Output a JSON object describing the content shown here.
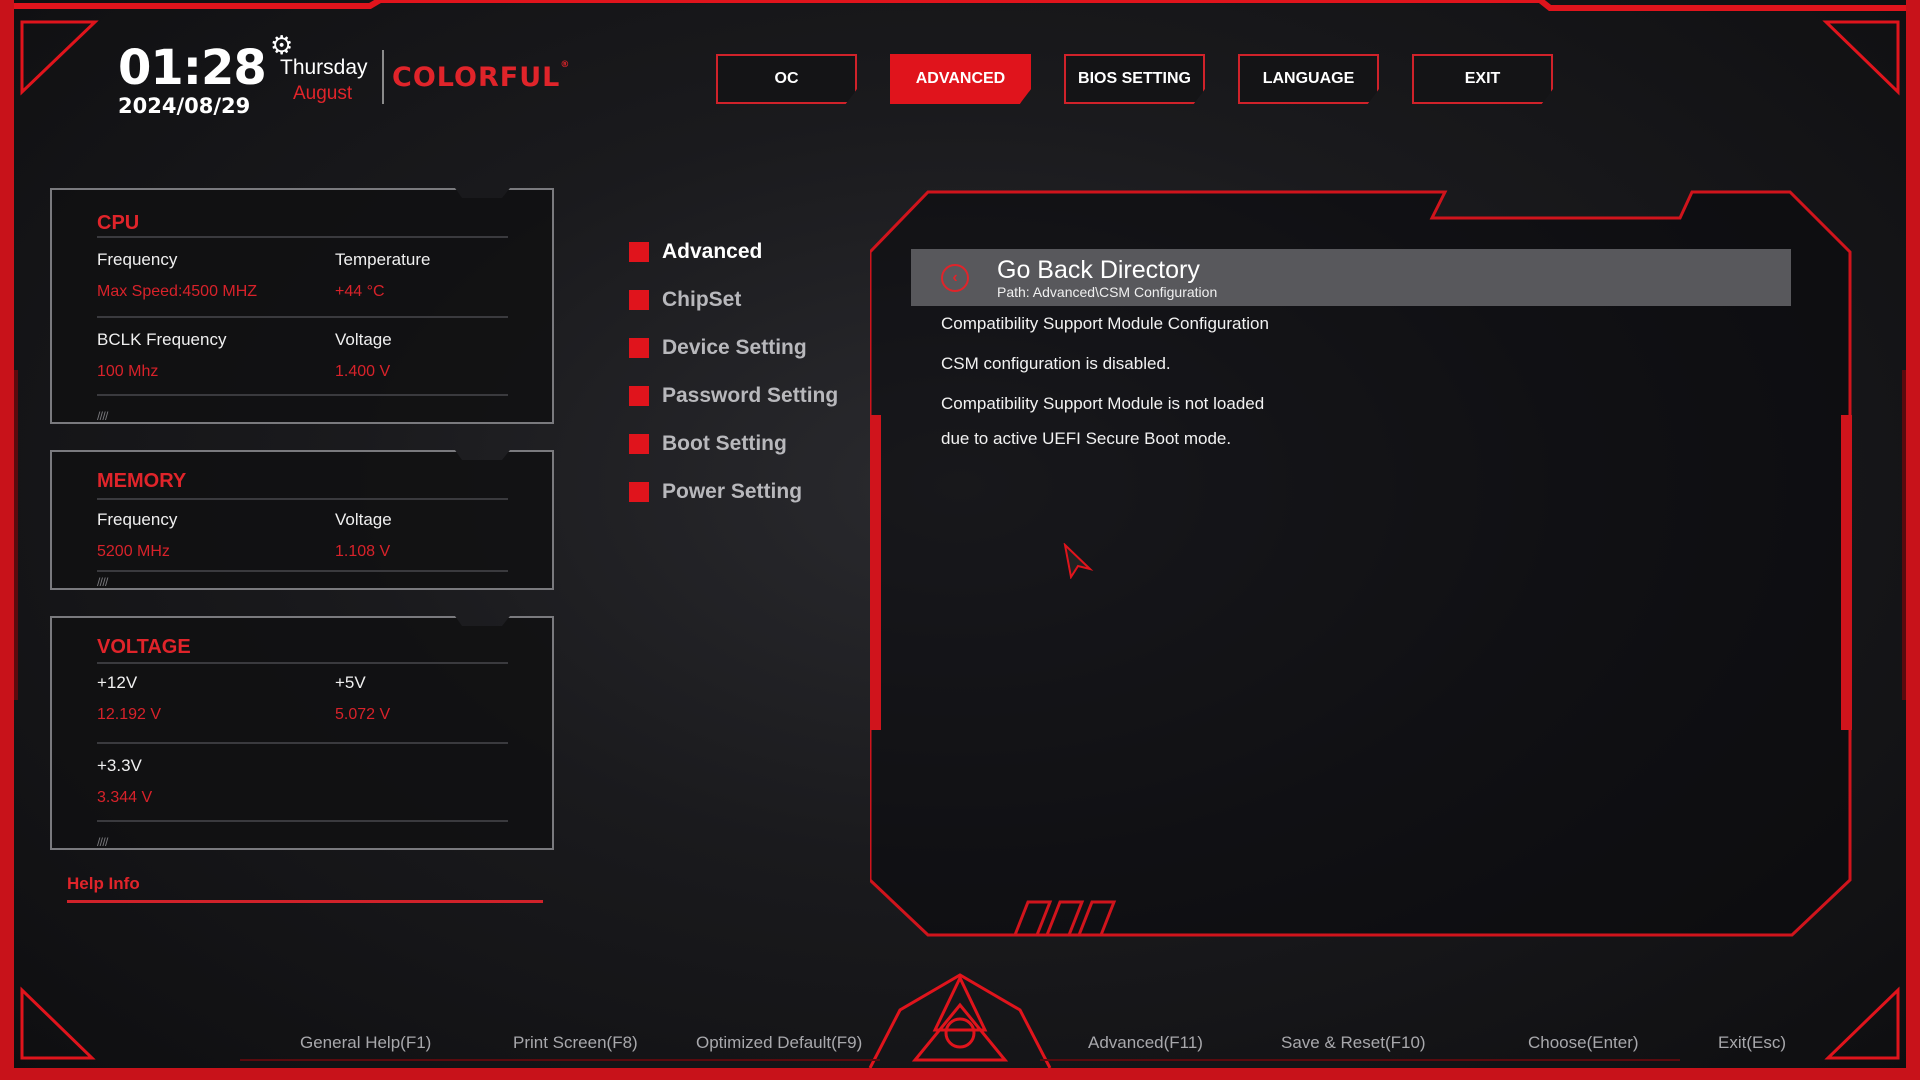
{
  "header": {
    "time": "01:28",
    "date": "2024/08/29",
    "day": "Thursday",
    "month": "August",
    "brand": "COLORFUL",
    "brand_mark": "®"
  },
  "topnav": [
    "OC",
    "ADVANCED",
    "BIOS SETTING",
    "LANGUAGE",
    "EXIT"
  ],
  "topnav_active": "ADVANCED",
  "cpu": {
    "title": "CPU",
    "frequency_label": "Frequency",
    "frequency_value": "Max Speed:4500 MHZ",
    "temperature_label": "Temperature",
    "temperature_value": "+44 °C",
    "bclk_label": "BCLK Frequency",
    "bclk_value": "100 Mhz",
    "voltage_label": "Voltage",
    "voltage_value": "1.400 V"
  },
  "memory": {
    "title": "MEMORY",
    "frequency_label": "Frequency",
    "frequency_value": "5200 MHz",
    "voltage_label": "Voltage",
    "voltage_value": "1.108 V"
  },
  "voltage": {
    "title": "VOLTAGE",
    "v12_label": "+12V",
    "v12_value": "12.192 V",
    "v5_label": "+5V",
    "v5_value": "5.072 V",
    "v33_label": "+3.3V",
    "v33_value": "3.344 V"
  },
  "help_info": "Help Info",
  "sidemenu": [
    "Advanced",
    "ChipSet",
    "Device Setting",
    "Password Setting",
    "Boot Setting",
    "Power Setting"
  ],
  "content": {
    "go_back_title": "Go Back Directory",
    "path": "Path: Advanced\\CSM Configuration",
    "lines": [
      "Compatibility Support Module Configuration",
      "CSM configuration is disabled.",
      "Compatibility Support Module is not loaded",
      "due to active UEFI Secure Boot mode."
    ]
  },
  "footer": [
    "General Help(F1)",
    "Print Screen(F8)",
    "Optimized Default(F9)",
    "Advanced(F11)",
    "Save & Reset(F10)",
    "Choose(Enter)",
    "Exit(Esc)"
  ],
  "colors": {
    "accent": "#e0141c",
    "panel_border": "#7a7a7e"
  }
}
